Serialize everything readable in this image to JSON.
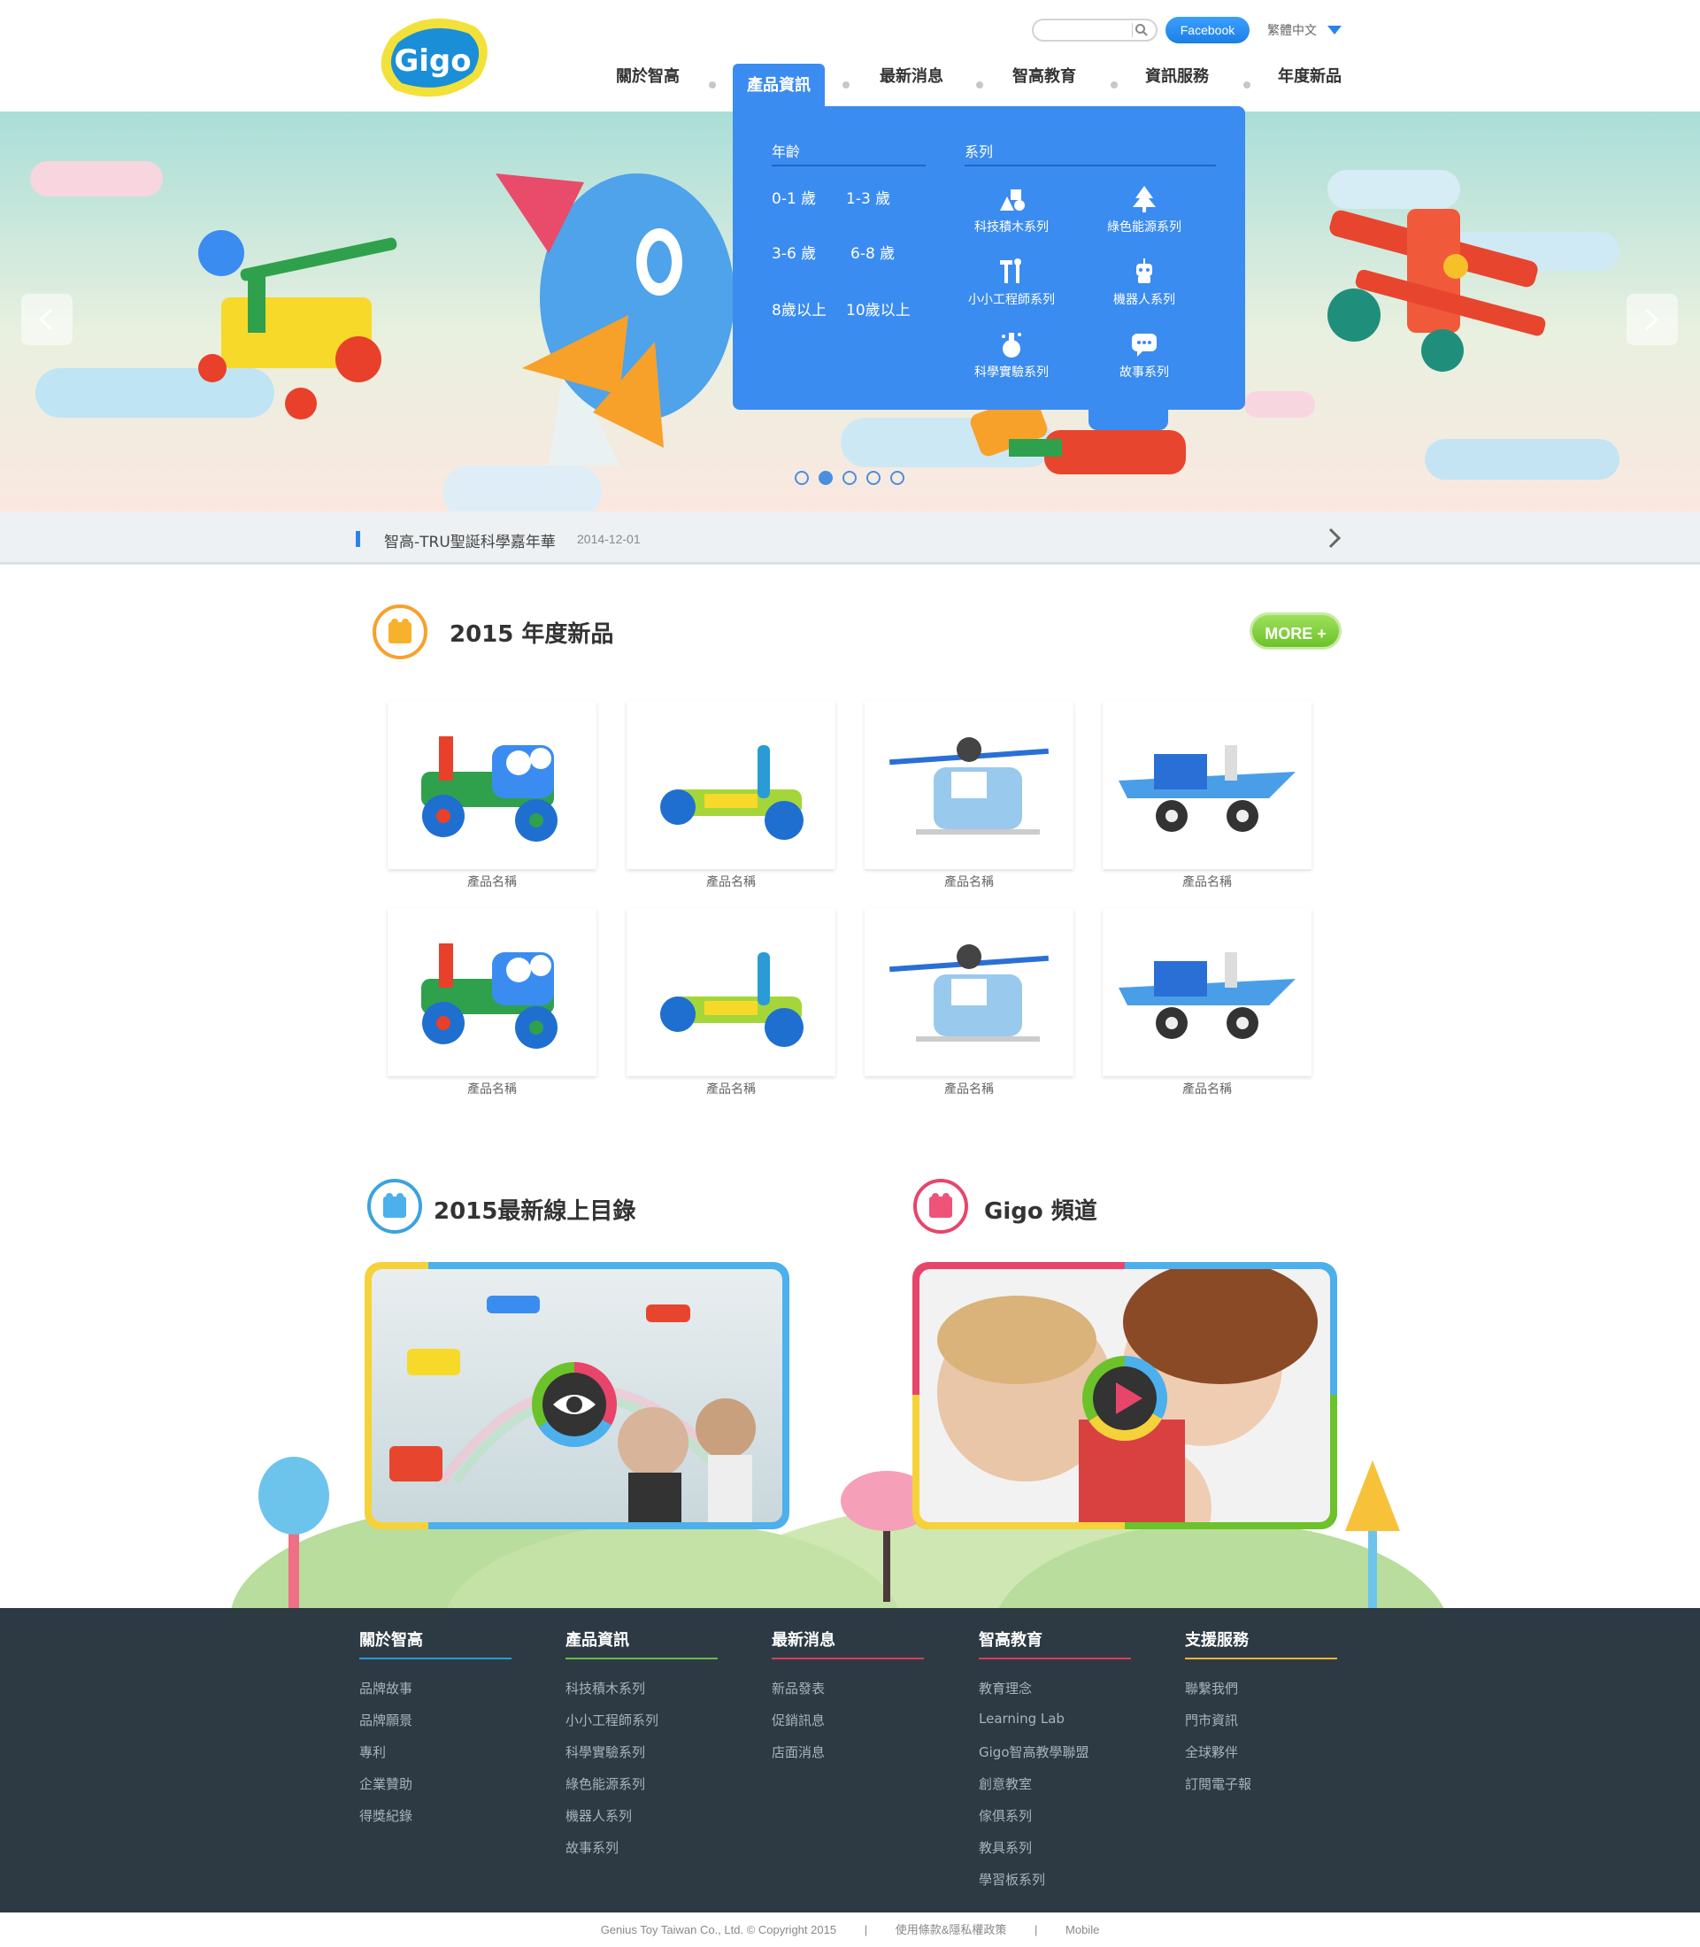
{
  "header": {
    "search": {
      "placeholder": "",
      "value": ""
    },
    "facebook_label": "Facebook",
    "language": "繁體中文",
    "nav": [
      "關於智高",
      "產品資訊",
      "最新消息",
      "智高教育",
      "資訊服務",
      "年度新品"
    ],
    "active_nav": "產品資訊"
  },
  "mega_menu": {
    "age_title": "年齡",
    "ages": [
      "0-1 歲",
      "1-3 歲",
      "3-6 歲",
      "6-8 歲",
      "8歲以上",
      "10歲以上"
    ],
    "series_title": "系列",
    "series": [
      {
        "label": "科技積木系列",
        "icon": "blocks-shapes-icon"
      },
      {
        "label": "綠色能源系列",
        "icon": "tree-icon"
      },
      {
        "label": "小小工程師系列",
        "icon": "tools-icon"
      },
      {
        "label": "機器人系列",
        "icon": "robot-icon"
      },
      {
        "label": "科學實驗系列",
        "icon": "flask-icon"
      },
      {
        "label": "故事系列",
        "icon": "speech-bubble-icon"
      }
    ]
  },
  "slider": {
    "dot_count": 5,
    "active_index": 1
  },
  "ticker": {
    "title": "智高-TRU聖誕科學嘉年華",
    "date": "2014-12-01"
  },
  "new_products": {
    "title": "2015 年度新品",
    "more_label": "MORE +",
    "products": [
      {
        "name": "產品名稱"
      },
      {
        "name": "產品名稱"
      },
      {
        "name": "產品名稱"
      },
      {
        "name": "產品名稱"
      },
      {
        "name": "產品名稱"
      },
      {
        "name": "產品名稱"
      },
      {
        "name": "產品名稱"
      },
      {
        "name": "產品名稱"
      }
    ]
  },
  "catalog": {
    "title": "2015最新線上目錄"
  },
  "channel": {
    "title": "Gigo 頻道"
  },
  "footer": {
    "columns": [
      {
        "title": "關於智高",
        "color": "#2a9bd6",
        "links": [
          "品牌故事",
          "品牌願景",
          "專利",
          "企業贊助",
          "得獎紀錄"
        ]
      },
      {
        "title": "產品資訊",
        "color": "#67b948",
        "links": [
          "科技積木系列",
          "小小工程師系列",
          "科學實驗系列",
          "綠色能源系列",
          "機器人系列",
          "故事系列"
        ]
      },
      {
        "title": "最新消息",
        "color": "#e0385c",
        "links": [
          "新品發表",
          "促銷訊息",
          "店面消息"
        ]
      },
      {
        "title": "智高教育",
        "color": "#e0385c",
        "links": [
          "教育理念",
          "Learning Lab",
          "Gigo智高教學聯盟",
          "創意教室",
          "傢俱系列",
          "教具系列",
          "學習板系列"
        ]
      },
      {
        "title": "支援服務",
        "color": "#f0b62c",
        "links": [
          "聯繫我們",
          "門市資訊",
          "全球夥伴",
          "訂閱電子報"
        ]
      }
    ],
    "copyright": "Genius Toy Taiwan Co., Ltd. © Copyright 2015",
    "terms": "使用條款&隱私權政策",
    "mobile": "Mobile",
    "separator": "|"
  },
  "colors": {
    "accent_blue": "#3b8cf0",
    "green": "#6cc22a",
    "footer_bg": "#2d3a44"
  }
}
